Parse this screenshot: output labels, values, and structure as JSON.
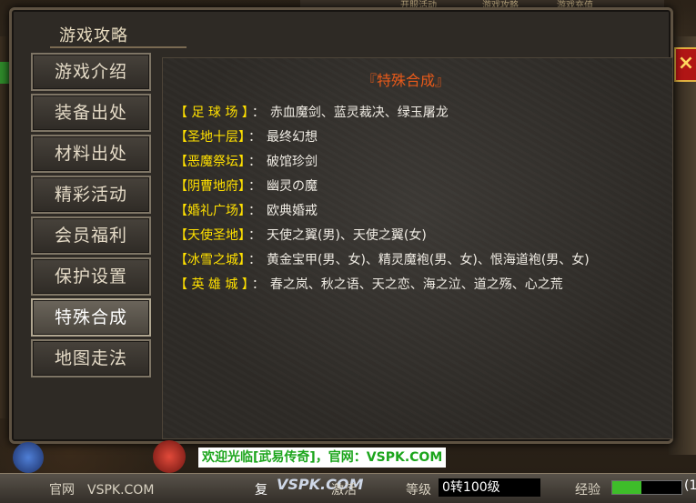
{
  "dialog": {
    "title": "游戏攻略"
  },
  "top_tabs": [
    "开服活动",
    "游戏攻略",
    "游戏充值"
  ],
  "menu": [
    {
      "label": "游戏介绍",
      "active": false
    },
    {
      "label": "装备出处",
      "active": false
    },
    {
      "label": "材料出处",
      "active": false
    },
    {
      "label": "精彩活动",
      "active": false
    },
    {
      "label": "会员福利",
      "active": false
    },
    {
      "label": "保护设置",
      "active": false
    },
    {
      "label": "特殊合成",
      "active": true
    },
    {
      "label": "地图走法",
      "active": false
    }
  ],
  "content": {
    "section_title": "『特殊合成』",
    "separator": "：",
    "rows": [
      {
        "location": "【 足 球 场 】",
        "items": "赤血魔剑、蓝灵裁决、绿玉屠龙"
      },
      {
        "location": "【圣地十层】",
        "items": "最终幻想"
      },
      {
        "location": "【恶魔祭坛】",
        "items": "破馆珍剑"
      },
      {
        "location": "【阴曹地府】",
        "items": "幽灵の魔"
      },
      {
        "location": "【婚礼广场】",
        "items": "欧典婚戒"
      },
      {
        "location": "【天使圣地】",
        "items": "天使之翼(男)、天使之翼(女)"
      },
      {
        "location": "【冰雪之城】",
        "items": "黄金宝甲(男、女)、精灵魔袍(男、女)、恨海道袍(男、女)"
      },
      {
        "location": "【 英 雄 城 】",
        "items": "春之岚、秋之语、天之恋、海之泣、道之殇、心之荒"
      }
    ]
  },
  "bottom_bar": {
    "welcome": "欢迎光临[武易传奇]，官网：VSPK.COM",
    "site_label": "官网　VSPK.COM",
    "revive_label": "复",
    "activate_label": "激活",
    "logo_text": "VSPK.COM",
    "level_label": "等级",
    "level_value": "0转100级",
    "exp_label": "经验",
    "exp_fill_fraction": 0.42,
    "exp_value": "(1"
  },
  "close_glyph": "×",
  "colors": {
    "location": "#ffe000",
    "section_title": "#e85a1a",
    "welcome_text": "#1ca51c",
    "exp_bar": "#3ebd2a"
  }
}
